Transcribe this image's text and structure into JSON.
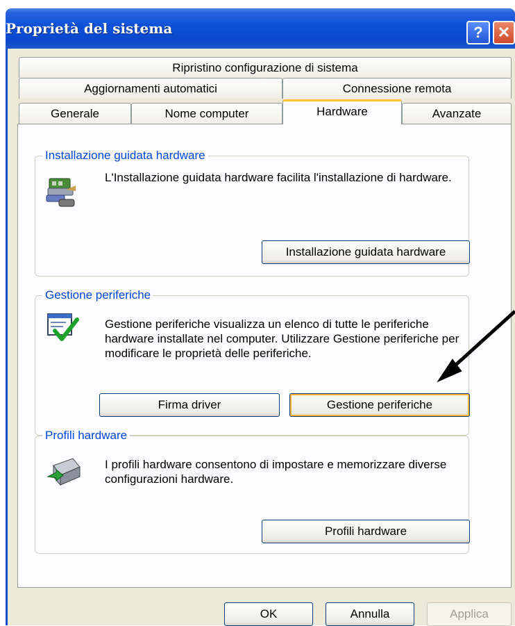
{
  "window": {
    "title": "Proprietà del sistema",
    "help_glyph": "?",
    "close_glyph": "✕"
  },
  "tabs": {
    "row1": [
      "Ripristino configurazione di sistema"
    ],
    "row2": [
      "Aggiornamenti automatici",
      "Connessione remota"
    ],
    "row3": [
      "Generale",
      "Nome computer",
      "Hardware",
      "Avanzate"
    ],
    "active": "Hardware"
  },
  "groups": {
    "wizard": {
      "legend": "Installazione guidata hardware",
      "text": "L'Installazione guidata hardware facilita l'installazione di hardware.",
      "button": "Installazione guidata hardware",
      "icon": "hardware-wizard-icon"
    },
    "devmgr": {
      "legend": "Gestione periferiche",
      "text": "Gestione periferiche visualizza un elenco di tutte le periferiche hardware installate nel computer. Utilizzare Gestione periferiche per modificare le proprietà delle periferiche.",
      "button_driver": "Firma driver",
      "button_devmgr": "Gestione periferiche",
      "icon": "device-manager-icon"
    },
    "profiles": {
      "legend": "Profili hardware",
      "text": "I profili hardware consentono di impostare e memorizzare diverse configurazioni hardware.",
      "button": "Profili hardware",
      "icon": "hardware-profiles-icon"
    }
  },
  "footer": {
    "ok": "OK",
    "cancel": "Annulla",
    "apply": "Applica"
  },
  "colors": {
    "titlebar": "#0a48cc",
    "focus_ring": "#f8b334",
    "legend": "#0046d5",
    "dialog_bg": "#ece9d8"
  }
}
